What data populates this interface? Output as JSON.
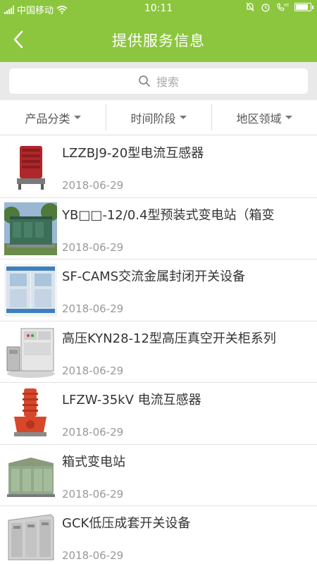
{
  "status_bar": {
    "carrier": "中国移动",
    "time": "10:11",
    "battery_level": 0.9,
    "icons": [
      "signal-icon",
      "wifi-icon",
      "alarm-off-icon",
      "alarm-clock-icon",
      "hd-call-icon",
      "battery-icon"
    ]
  },
  "header": {
    "title": "提供服务信息",
    "back_icon": "back-arrow-icon",
    "color": "#8cc63f"
  },
  "search": {
    "placeholder": "搜索",
    "icon": "search-icon"
  },
  "filters": [
    {
      "label": "产品分类"
    },
    {
      "label": "时间阶段"
    },
    {
      "label": "地区领域"
    }
  ],
  "items": [
    {
      "title": "LZZBJ9-20型电流互感器",
      "date": "2018-06-29",
      "thumb": "red-current-transformer"
    },
    {
      "title": "YB□□-12/0.4型预装式变电站（箱变",
      "date": "2018-06-29",
      "thumb": "green-box-substation-outdoor"
    },
    {
      "title": "SF-CAMS交流金属封闭开关设备",
      "date": "2018-06-29",
      "thumb": "blue-switchgear-cabinet"
    },
    {
      "title": "高压KYN28-12型高压真空开关柜系列",
      "date": "2018-06-29",
      "thumb": "grey-vacuum-switchgear"
    },
    {
      "title": "LFZW-35kV 电流互感器",
      "date": "2018-06-29",
      "thumb": "orange-current-transformer"
    },
    {
      "title": "箱式变电站",
      "date": "2018-06-29",
      "thumb": "green-box-substation"
    },
    {
      "title": "GCK低压成套开关设备",
      "date": "2018-06-29",
      "thumb": "grey-low-voltage-switchgear"
    }
  ]
}
